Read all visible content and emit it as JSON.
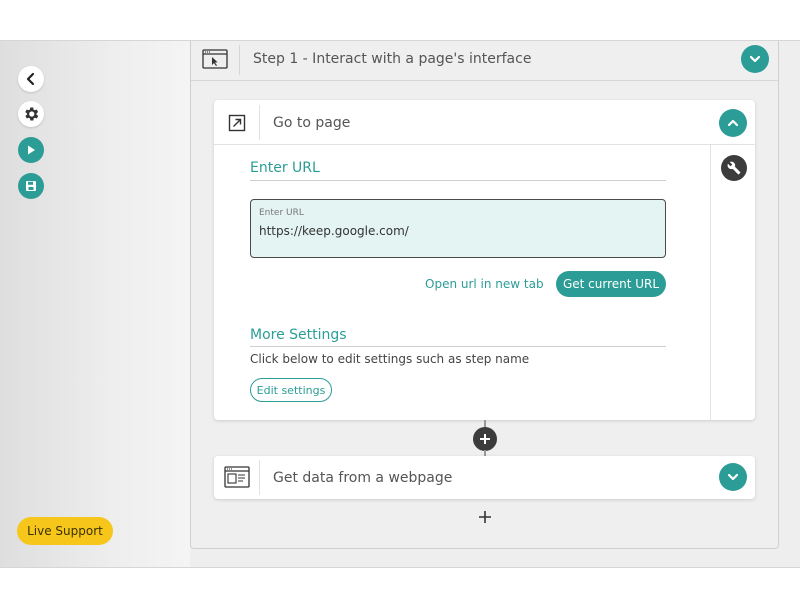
{
  "step": {
    "title": "Step 1 - Interact with a page's interface"
  },
  "go_to_page": {
    "title": "Go to page",
    "enter_url_heading": "Enter URL",
    "url_field": {
      "caption": "Enter URL",
      "value": "https://keep.google.com/"
    },
    "open_new_tab_label": "Open url in new tab",
    "get_current_url_label": "Get current URL",
    "more_settings_heading": "More Settings",
    "more_settings_helper": "Click below to edit settings such as step name",
    "edit_settings_label": "Edit settings"
  },
  "get_data": {
    "title": "Get data from a webpage"
  },
  "sidebar": {
    "live_support_label": "Live Support"
  },
  "colors": {
    "accent": "#2b9d96",
    "dark": "#3c3c3c",
    "support": "#f6c61b",
    "url_bg": "#e4f4f2"
  },
  "icons": [
    "back-icon",
    "gear-icon",
    "play-icon",
    "save-icon",
    "browser-cursor-icon",
    "chevron-down-icon",
    "chevron-up-icon",
    "open-external-icon",
    "wrench-icon",
    "plus-icon",
    "scrape-data-icon"
  ]
}
